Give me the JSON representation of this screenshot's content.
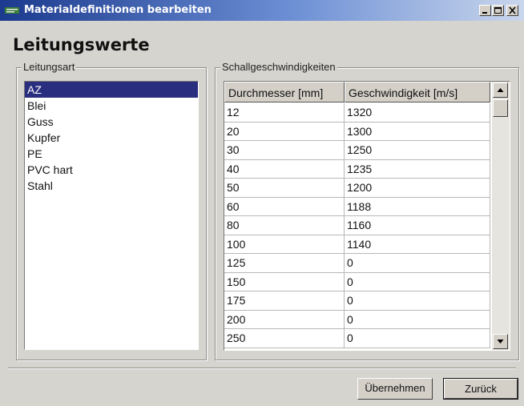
{
  "window": {
    "title": "Materialdefinitionen bearbeiten"
  },
  "heading": "Leitungswerte",
  "leitungsart": {
    "legend": "Leitungsart",
    "items": [
      "AZ",
      "Blei",
      "Guss",
      "Kupfer",
      "PE",
      "PVC hart",
      "Stahl"
    ],
    "selected_index": 0
  },
  "schall": {
    "legend": "Schallgeschwindigkeiten",
    "columns": [
      "Durchmesser [mm]",
      "Geschwindigkeit [m/s]"
    ],
    "rows": [
      [
        "12",
        "1320"
      ],
      [
        "20",
        "1300"
      ],
      [
        "30",
        "1250"
      ],
      [
        "40",
        "1235"
      ],
      [
        "50",
        "1200"
      ],
      [
        "60",
        "1188"
      ],
      [
        "80",
        "1160"
      ],
      [
        "100",
        "1140"
      ],
      [
        "125",
        "0"
      ],
      [
        "150",
        "0"
      ],
      [
        "175",
        "0"
      ],
      [
        "200",
        "0"
      ],
      [
        "250",
        "0"
      ]
    ]
  },
  "buttons": {
    "apply_label": "Übernehmen",
    "back_label": "Zurück"
  },
  "colors": {
    "selection": "#2a2e7e",
    "titlebar": "#1c3a8e"
  }
}
